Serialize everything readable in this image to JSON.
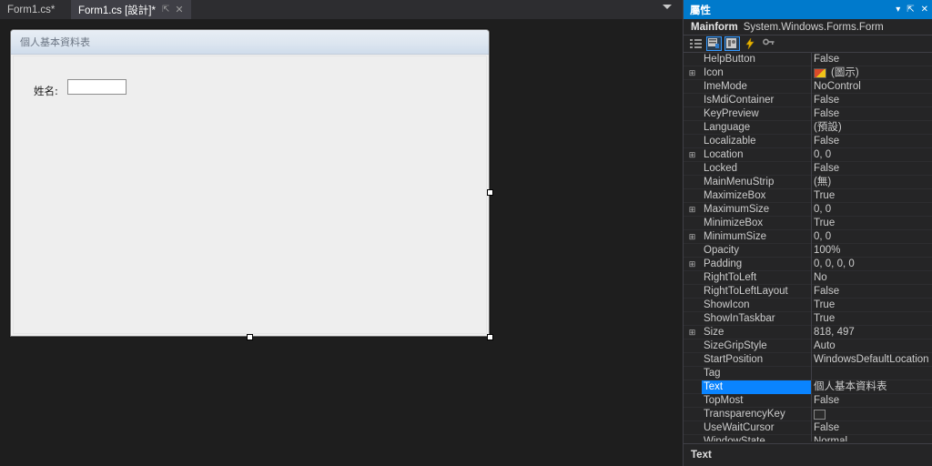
{
  "editor": {
    "tabs": [
      {
        "label": "Form1.cs*",
        "active": false
      },
      {
        "label": "Form1.cs [設計]*",
        "active": true
      }
    ],
    "tab_pin_icon": "pin-icon",
    "tab_close_icon": "close-icon",
    "overflow_icon": "chevron-down-icon"
  },
  "form": {
    "title": "個人基本資料表",
    "label_name": "姓名:",
    "textbox_value": ""
  },
  "properties_panel": {
    "title": "屬性",
    "object_name": "Mainform",
    "object_type": "System.Windows.Forms.Form",
    "titlebar_icons": [
      "chevron-down-icon",
      "pin-icon",
      "close-icon"
    ],
    "toolbar_buttons": [
      {
        "name": "categorized-view-button",
        "selected": false
      },
      {
        "name": "alphabetical-view-button",
        "selected": true
      },
      {
        "name": "properties-view-button",
        "selected": true
      },
      {
        "name": "events-view-button",
        "selected": false
      },
      {
        "name": "property-pages-button",
        "selected": false
      }
    ],
    "rows": [
      {
        "name": "HelpButton",
        "value": "False",
        "expandable": false,
        "selected": false
      },
      {
        "name": "Icon",
        "value": "(圖示)",
        "expandable": true,
        "selected": false,
        "swatch": "icon"
      },
      {
        "name": "ImeMode",
        "value": "NoControl",
        "expandable": false,
        "selected": false
      },
      {
        "name": "IsMdiContainer",
        "value": "False",
        "expandable": false,
        "selected": false
      },
      {
        "name": "KeyPreview",
        "value": "False",
        "expandable": false,
        "selected": false
      },
      {
        "name": "Language",
        "value": "(預設)",
        "expandable": false,
        "selected": false
      },
      {
        "name": "Localizable",
        "value": "False",
        "expandable": false,
        "selected": false
      },
      {
        "name": "Location",
        "value": "0, 0",
        "expandable": true,
        "selected": false
      },
      {
        "name": "Locked",
        "value": "False",
        "expandable": false,
        "selected": false
      },
      {
        "name": "MainMenuStrip",
        "value": "(無)",
        "expandable": false,
        "selected": false
      },
      {
        "name": "MaximizeBox",
        "value": "True",
        "expandable": false,
        "selected": false
      },
      {
        "name": "MaximumSize",
        "value": "0, 0",
        "expandable": true,
        "selected": false
      },
      {
        "name": "MinimizeBox",
        "value": "True",
        "expandable": false,
        "selected": false
      },
      {
        "name": "MinimumSize",
        "value": "0, 0",
        "expandable": true,
        "selected": false
      },
      {
        "name": "Opacity",
        "value": "100%",
        "expandable": false,
        "selected": false
      },
      {
        "name": "Padding",
        "value": "0, 0, 0, 0",
        "expandable": true,
        "selected": false
      },
      {
        "name": "RightToLeft",
        "value": "No",
        "expandable": false,
        "selected": false
      },
      {
        "name": "RightToLeftLayout",
        "value": "False",
        "expandable": false,
        "selected": false
      },
      {
        "name": "ShowIcon",
        "value": "True",
        "expandable": false,
        "selected": false
      },
      {
        "name": "ShowInTaskbar",
        "value": "True",
        "expandable": false,
        "selected": false
      },
      {
        "name": "Size",
        "value": "818, 497",
        "expandable": true,
        "selected": false
      },
      {
        "name": "SizeGripStyle",
        "value": "Auto",
        "expandable": false,
        "selected": false
      },
      {
        "name": "StartPosition",
        "value": "WindowsDefaultLocation",
        "expandable": false,
        "selected": false
      },
      {
        "name": "Tag",
        "value": "",
        "expandable": false,
        "selected": false
      },
      {
        "name": "Text",
        "value": "個人基本資料表",
        "expandable": false,
        "selected": true
      },
      {
        "name": "TopMost",
        "value": "False",
        "expandable": false,
        "selected": false
      },
      {
        "name": "TransparencyKey",
        "value": "",
        "expandable": false,
        "selected": false,
        "swatch": "color"
      },
      {
        "name": "UseWaitCursor",
        "value": "False",
        "expandable": false,
        "selected": false
      },
      {
        "name": "WindowState",
        "value": "Normal",
        "expandable": false,
        "selected": false
      }
    ],
    "description_title": "Text"
  },
  "colors": {
    "accent": "#007acc",
    "selection": "#0a84ff",
    "panel_bg": "#252526",
    "canvas_bg": "#1e1e1e",
    "tab_active_bg": "#3f3f46"
  }
}
